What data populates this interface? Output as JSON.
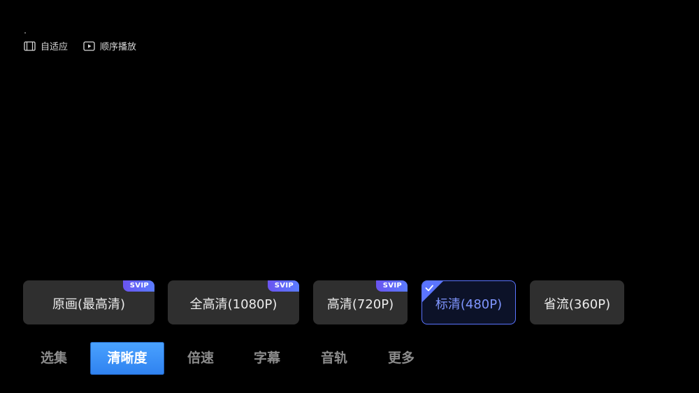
{
  "top_bar": {
    "items": [
      {
        "label": "自适应",
        "icon": "film-icon"
      },
      {
        "label": "顺序播放",
        "icon": "play-icon"
      }
    ]
  },
  "quality": {
    "badge_label": "SVIP",
    "options": [
      {
        "label": "原画(最高清)",
        "svip": true,
        "selected": false
      },
      {
        "label": "全高清(1080P)",
        "svip": true,
        "selected": false
      },
      {
        "label": "高清(720P)",
        "svip": true,
        "selected": false
      },
      {
        "label": "标清(480P)",
        "svip": false,
        "selected": true
      },
      {
        "label": "省流(360P)",
        "svip": false,
        "selected": false
      }
    ]
  },
  "tabs": [
    {
      "label": "选集",
      "active": false
    },
    {
      "label": "清晰度",
      "active": true
    },
    {
      "label": "倍速",
      "active": false
    },
    {
      "label": "字幕",
      "active": false
    },
    {
      "label": "音轨",
      "active": false
    },
    {
      "label": "更多",
      "active": false
    }
  ],
  "colors": {
    "accent": "#3a8cf5",
    "selected_border": "#5a74ff",
    "selected_text": "#7f95ff",
    "svip_badge": "#5a6cf5",
    "card_bg": "#2f2f2f"
  }
}
